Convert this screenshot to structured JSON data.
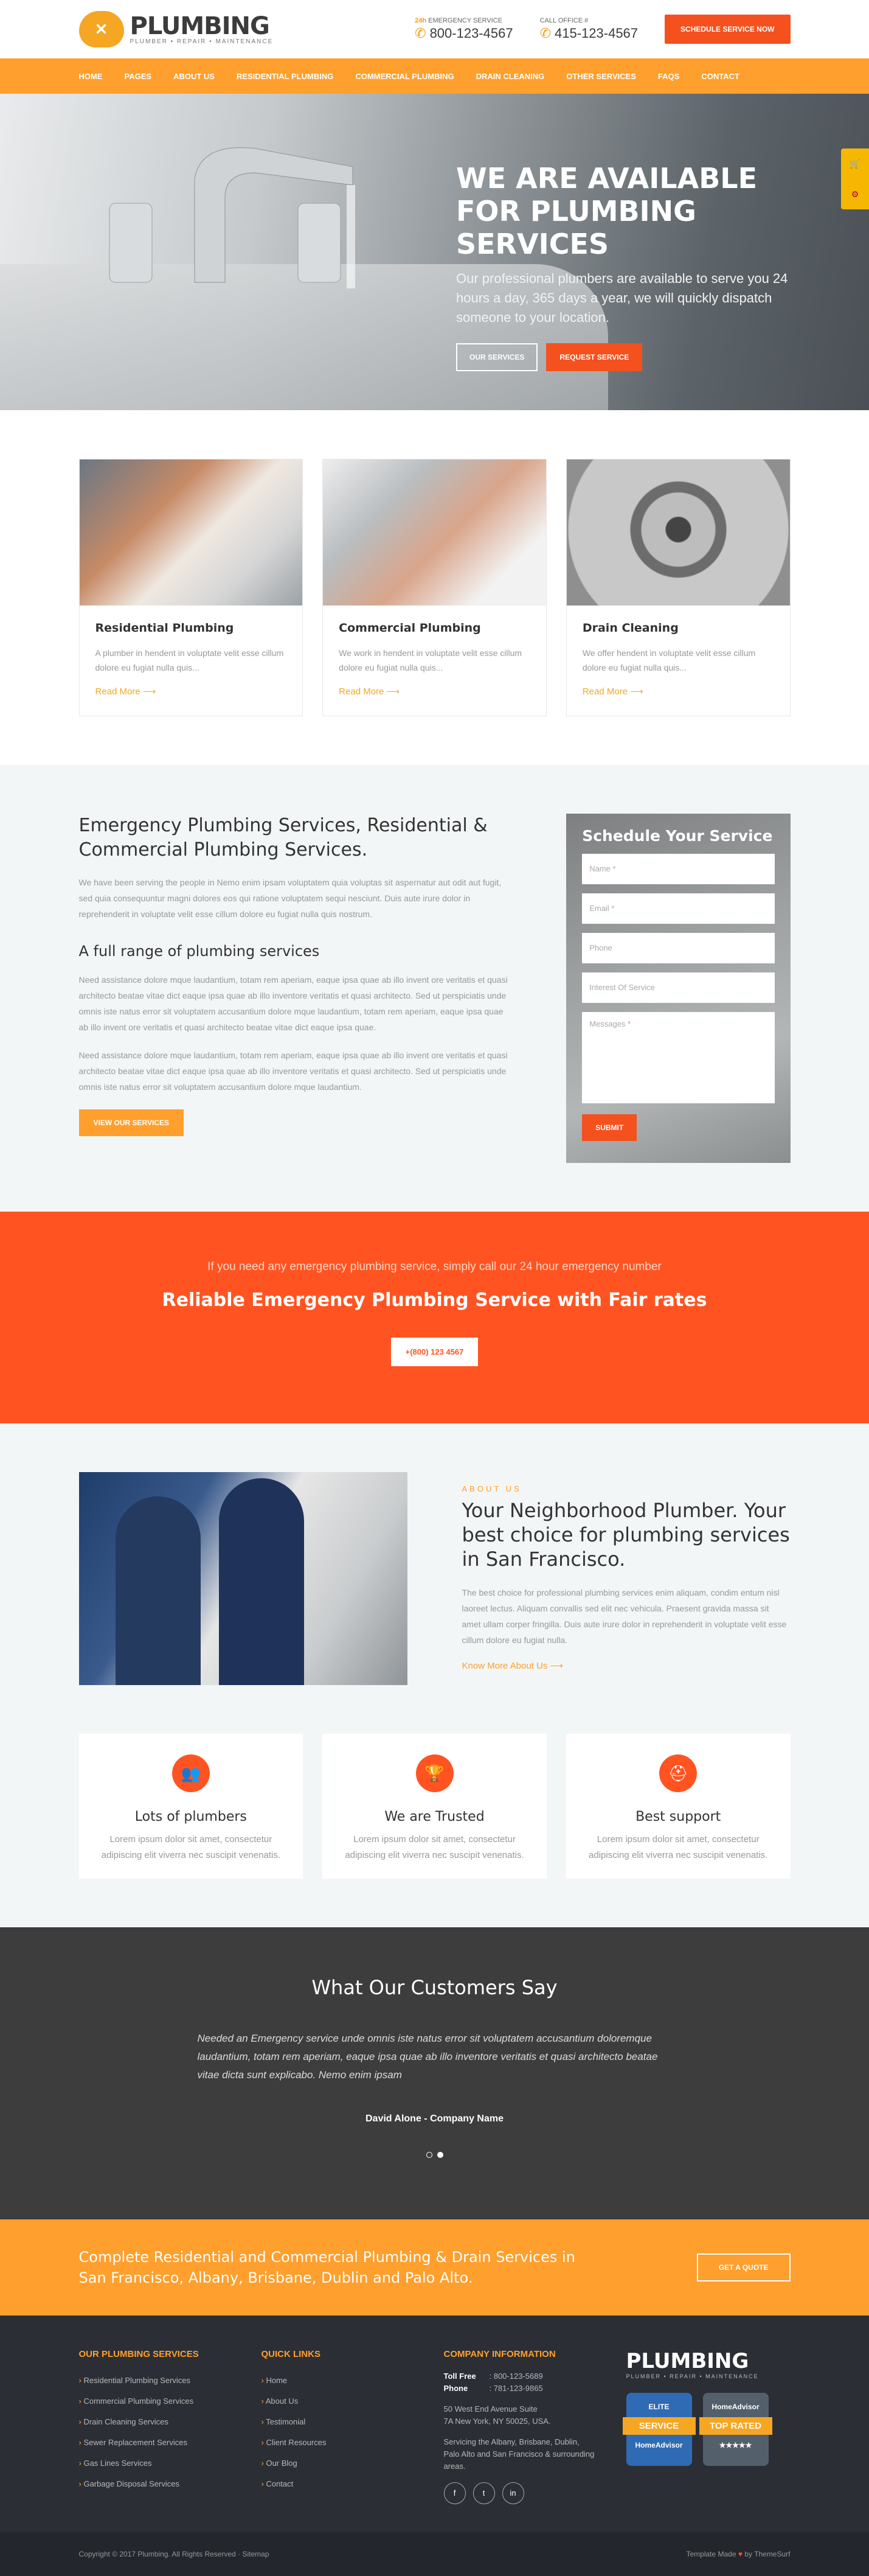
{
  "header": {
    "brand_name": "PLUMBING",
    "brand_tagline": "PLUMBER • REPAIR • MAINTENANCE",
    "emergency_label_highlight": "24h",
    "emergency_label": "EMERGENCY SERVICE",
    "emergency_phone": "800-123-4567",
    "office_label": "CALL OFFICE #",
    "office_phone": "415-123-4567",
    "schedule_button": "SCHEDULE SERVICE NOW"
  },
  "nav": {
    "items": [
      "HOME",
      "PAGES",
      "ABOUT US",
      "RESIDENTIAL PLUMBING",
      "COMMERCIAL PLUMBING",
      "DRAIN CLEANING",
      "OTHER SERVICES",
      "FAQS",
      "CONTACT"
    ]
  },
  "hero": {
    "title": "WE ARE AVAILABLE FOR PLUMBING SERVICES",
    "text": "Our professional plumbers are available to serve you 24 hours a day, 365 days a year, we will quickly dispatch someone to your location.",
    "btn_services": "OUR SERVICES",
    "btn_request": "REQUEST SERVICE"
  },
  "services": [
    {
      "title": "Residential Plumbing",
      "text": "A plumber in hendent in voluptate velit esse cillum dolore eu fugiat nulla quis...",
      "more": "Read More"
    },
    {
      "title": "Commercial Plumbing",
      "text": "We work in hendent in voluptate velit esse cillum dolore eu fugiat nulla quis...",
      "more": "Read More"
    },
    {
      "title": "Drain Cleaning",
      "text": "We offer hendent in voluptate velit esse cillum dolore eu fugiat nulla quis...",
      "more": "Read More"
    }
  ],
  "emergency": {
    "title": "Emergency Plumbing Services, Residential & Commercial Plumbing Services.",
    "intro": "We have been serving the people in Nemo enim ipsam voluptatem quia voluptas sit aspernatur aut odit aut fugit, sed quia consequuntur magni dolores eos qui ratione voluptatem sequi nesciunt. Duis aute irure dolor in reprehenderit in voluptate velit esse cillum dolore eu fugiat nulla quis nostrum.",
    "subtitle": "A full range of plumbing services",
    "para1": "Need assistance dolore mque laudantium, totam rem aperiam, eaque ipsa quae ab illo invent ore veritatis et quasi architecto beatae vitae dict eaque ipsa quae ab illo inventore veritatis et quasi architecto. Sed ut perspiciatis unde omnis iste natus error sit voluptatem accusantium dolore mque laudantium, totam rem aperiam, eaque ipsa quae ab illo invent ore veritatis et quasi architecto beatae vitae dict eaque ipsa quae.",
    "para2": "Need assistance dolore mque laudantium, totam rem aperiam, eaque ipsa quae ab illo invent ore veritatis et quasi architecto beatae vitae dict eaque ipsa quae ab illo inventore veritatis et quasi architecto. Sed ut perspiciatis unde omnis iste natus error sit voluptatem accusantium dolore mque laudantium.",
    "button": "VIEW OUR SERVICES"
  },
  "form": {
    "title": "Schedule Your Service",
    "name": "Name *",
    "email": "Email *",
    "phone": "Phone",
    "interest": "Interest Of Service",
    "messages": "Messages *",
    "submit": "SUBMIT"
  },
  "cta": {
    "line1": "If you need any emergency plumbing service, simply call our 24 hour emergency number",
    "line2": "Reliable Emergency Plumbing Service with Fair rates",
    "phone_button": "+(800) 123 4567"
  },
  "about": {
    "label": "ABOUT US",
    "title": "Your Neighborhood Plumber. Your best choice for plumbing services in San Francisco.",
    "text": "The best choice for professional plumbing services enim aliquam, condim entum nisl laoreet lectus. Aliquam convallis sed elit nec vehicula. Praesent gravida massa sit amet ullam corper fringilla. Duis aute irure dolor in reprehenderit in voluptate velit esse cillum dolore eu fugiat nulla.",
    "more": "Know More About Us"
  },
  "features": [
    {
      "title": "Lots of plumbers",
      "text": "Lorem ipsum dolor sit amet, consectetur adipiscing elit viverra nec suscipit venenatis."
    },
    {
      "title": "We are Trusted",
      "text": "Lorem ipsum dolor sit amet, consectetur adipiscing elit viverra nec suscipit venenatis."
    },
    {
      "title": "Best support",
      "text": "Lorem ipsum dolor sit amet, consectetur adipiscing elit viverra nec suscipit venenatis."
    }
  ],
  "testimonials": {
    "title": "What Our Customers Say",
    "quote": "Needed an Emergency service unde omnis iste natus error sit voluptatem accusantium doloremque laudantium, totam rem aperiam, eaque ipsa quae ab illo inventore veritatis et quasi architecto beatae vitae dicta sunt explicabo. Nemo enim ipsam",
    "author": "David Alone - Company Name"
  },
  "quote_strip": {
    "text": "Complete Residential and Commercial Plumbing & Drain Services in San Francisco, Albany, Brisbane, Dublin and Palo Alto.",
    "button": "GET A QUOTE"
  },
  "footer": {
    "services_title": "OUR PLUMBING SERVICES",
    "services": [
      "Residential Plumbing Services",
      "Commercial Plumbing Services",
      "Drain Cleaning Services",
      "Sewer Replacement Services",
      "Gas Lines Services",
      "Garbage Disposal Services"
    ],
    "links_title": "QUICK LINKS",
    "links": [
      "Home",
      "About Us",
      "Testimonial",
      "Client Resources",
      "Our Blog",
      "Contact"
    ],
    "company_title": "COMPANY INFORMATION",
    "toll_free_label": "Toll Free",
    "toll_free": ": 800-123-5689",
    "phone_label": "Phone",
    "phone": ": 781-123-9865",
    "address1": "50 West End Avenue Suite",
    "address2": "7A New York, NY 50025, USA.",
    "serving": "Servicing the Albany, Brisbane, Dublin, Palo Alto and San Francisco & surrounding areas.",
    "brand_name": "PLUMBING",
    "brand_tagline": "PLUMBER • REPAIR • MAINTENANCE",
    "badge1_top": "ELITE",
    "badge1_big": "SERVICE",
    "badge1_bottom": "HomeAdvisor",
    "badge2_top": "HomeAdvisor",
    "badge2_big": "TOP RATED",
    "copyright": "Copyright © 2017 Plumbing. All Rights Reserved",
    "sitemap": "Sitemap",
    "credit_pre": "Template Made",
    "credit_post": "by ThemeSurf"
  },
  "colors": {
    "orange": "#ff9f2d",
    "red": "#ff5422",
    "dark": "#3d3d3d",
    "footer": "#2b2e35"
  }
}
